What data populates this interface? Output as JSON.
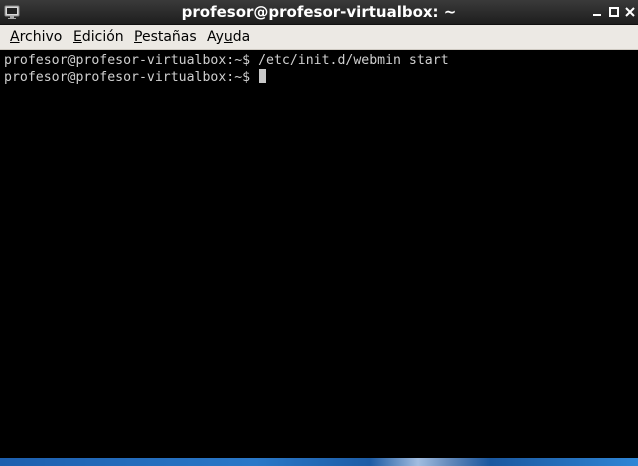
{
  "window": {
    "title": "profesor@profesor-virtualbox: ~",
    "icons": {
      "app": "terminal-icon",
      "minimize": "minimize-icon",
      "maximize": "maximize-icon",
      "close": "close-icon"
    }
  },
  "menu": {
    "items": [
      {
        "underline": "A",
        "rest": "rchivo"
      },
      {
        "underline": "E",
        "rest": "dición"
      },
      {
        "underline": "P",
        "rest": "estañas"
      },
      {
        "pre": "Ay",
        "underline": "u",
        "rest": "da"
      }
    ]
  },
  "terminal": {
    "lines": [
      {
        "prompt": "profesor@profesor-virtualbox:~$ ",
        "command": "/etc/init.d/webmin start"
      },
      {
        "prompt": "profesor@profesor-virtualbox:~$ ",
        "command": ""
      }
    ]
  },
  "colors": {
    "titlebar": "#2b2b2b",
    "menubar": "#ece9e4",
    "terminal_bg": "#000000",
    "terminal_fg": "#d0d0d0"
  }
}
